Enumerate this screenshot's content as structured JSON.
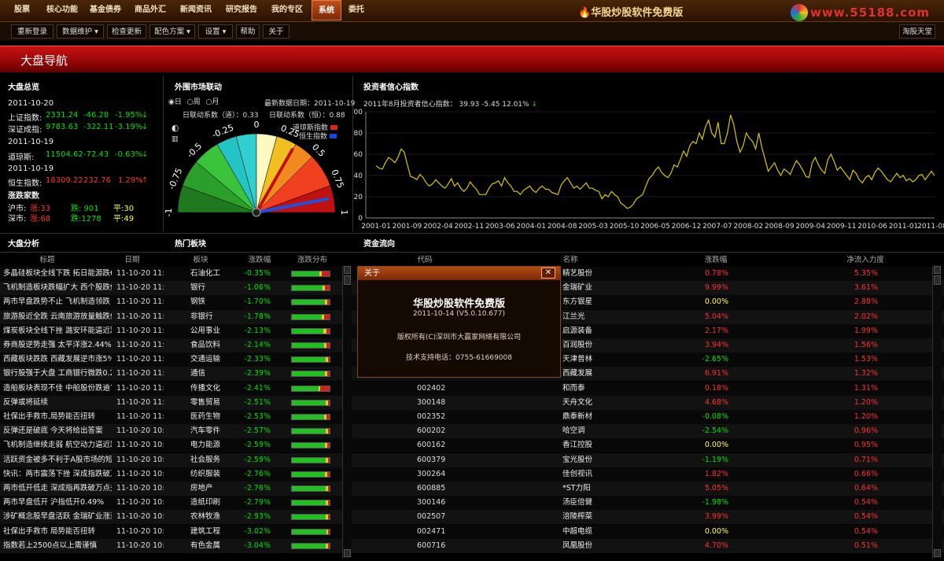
{
  "menu": [
    "股票",
    "核心功能",
    "基金债券",
    "商品外汇",
    "新闻资讯",
    "研究报告",
    "我的专区",
    "系统",
    "委托"
  ],
  "active_menu": 7,
  "app_title": "华股炒股软件免费版",
  "watermark_url": "www.55188.com",
  "toolbar": [
    "重新登录",
    "数据维护 ▾",
    "检查更新",
    "配色方案 ▾",
    "设置 ▾",
    "帮助",
    "关于"
  ],
  "toolbar_right": "淘股天堂",
  "banner_title": "大盘导航",
  "overview": {
    "title": "大盘总览",
    "date1": "2011-10-20",
    "sh_label": "上证指数:",
    "sh_val": "2331.24",
    "sh_chg": "-46.28",
    "sh_pct": "-1.95%",
    "sz_label": "深证成指:",
    "sz_val": "9783.63",
    "sz_chg": "-322.11",
    "sz_pct": "-3.19%",
    "date2": "2011-10-19",
    "dj_label": "道琼斯:",
    "dj_val": "11504.62",
    "dj_chg": "-72.43",
    "dj_pct": "-0.63%",
    "date3": "2011-10-19",
    "hs_label": "恒生指数:",
    "hs_val": "18309.22",
    "hs_chg": "232.76",
    "hs_pct": "1.29%",
    "updown_title": "涨跌家数",
    "sh_market": "沪市:",
    "sh_up": "涨:33",
    "sh_down": "跌: 901",
    "sh_flat": "平:30",
    "sz_market": "深市:",
    "sz_up": "涨:68",
    "sz_down": "跌:1278",
    "sz_flat": "平:49"
  },
  "external": {
    "title": "外围市场联动",
    "opt_day": "日",
    "opt_week": "周",
    "opt_month": "月",
    "latest_date": "最新数据日期：2011-10-19",
    "coef_dj": "日联动系数（道）：0.33",
    "coef_hs": "日联动系数（恒）：0.88",
    "legend_dj": "道琼斯指数",
    "legend_hs": "恒生指数",
    "ticks": [
      "-1",
      "-0.75",
      "-0.5",
      "-0.25",
      "0",
      "0.25",
      "0.5",
      "0.75",
      "1"
    ]
  },
  "confidence": {
    "title": "投资者信心指数",
    "header": "2011年8月投资者信心指数：  39.93   -5.45   12.01%",
    "y_ticks": [
      "100",
      "80",
      "60",
      "40",
      "20",
      "0"
    ],
    "x_ticks": [
      "2001-01",
      "2001-09",
      "2002-04",
      "2002-11",
      "2003-06",
      "2004-01",
      "2004-08",
      "2005-03",
      "2005-10",
      "2006-05",
      "2006-12",
      "2007-07",
      "2008-02",
      "2008-09",
      "2009-04",
      "2009-11",
      "2010-06",
      "2011-01",
      "2011-08"
    ]
  },
  "chart_data": {
    "type": "line",
    "title": "投资者信心指数",
    "ylim": [
      0,
      100
    ],
    "x_range": [
      "2001-01",
      "2011-08"
    ],
    "series": [
      {
        "values": [
          49,
          47,
          46,
          52,
          57,
          55,
          52,
          57,
          65,
          62,
          50,
          39,
          38,
          36,
          41,
          38,
          33,
          30,
          32,
          36,
          33,
          30,
          28,
          32,
          37,
          30,
          33,
          28,
          25,
          28,
          34,
          30,
          27,
          22,
          22,
          22,
          28,
          32,
          33,
          35,
          30,
          38,
          33,
          30,
          25,
          25,
          22,
          26,
          28,
          30,
          26,
          24,
          28,
          30,
          27,
          27,
          24,
          23,
          22,
          31,
          35,
          38,
          33,
          28,
          30,
          27,
          30,
          33,
          28,
          28,
          26,
          25,
          18,
          22,
          20,
          25,
          22,
          20,
          14,
          12,
          9,
          10,
          13,
          18,
          20,
          22,
          30,
          37,
          40,
          45,
          48,
          43,
          40,
          38,
          42,
          50,
          48,
          55,
          63,
          58,
          68,
          72,
          70,
          80,
          74,
          86,
          92,
          80,
          76,
          90,
          70,
          70,
          80,
          97,
          88,
          72,
          62,
          68,
          80,
          75,
          72,
          65,
          80,
          66,
          55,
          44,
          48,
          52,
          45,
          40,
          46,
          44,
          41,
          48,
          54,
          50,
          45,
          39,
          38,
          52,
          57,
          50,
          45,
          42,
          55,
          60,
          53,
          45,
          48,
          44,
          40,
          36,
          45,
          42,
          36,
          33,
          38,
          40,
          36,
          43,
          47,
          44,
          40,
          36,
          34,
          38,
          42,
          38,
          40,
          35,
          37,
          34,
          36,
          40,
          41,
          36,
          40,
          44,
          40
        ]
      }
    ]
  },
  "analysis": {
    "title": "大盘分析",
    "col_title": "标题",
    "col_date": "日期",
    "rows": [
      {
        "t": "多晶硅板块全线下跌 拓日能源跌6...",
        "d": "11-10-20 11:37"
      },
      {
        "t": "飞机制造板块跌幅扩大 西个股跌停",
        "d": "11-10-20 11:37"
      },
      {
        "t": "两市早盘跌势不止 飞机制造领跌",
        "d": "11-10-20 11:37"
      },
      {
        "t": "旅游股近全跌 云南旅游放量触跌停",
        "d": "11-10-20 11:37"
      },
      {
        "t": "煤炭板块全线下挫 潞安环能逼近跌停",
        "d": "11-10-20 11:37"
      },
      {
        "t": "券商股逆势走强 太平洋涨2.44%",
        "d": "11-10-20 11:37"
      },
      {
        "t": "西藏板块跌跌 西藏发展逆市涨5%",
        "d": "11-10-20 11:37"
      },
      {
        "t": "银行股强于大盘 工商银行微跌0.24%",
        "d": "11-10-20 11:37"
      },
      {
        "t": "造船板块表现不佳 中船股份跌逾7%",
        "d": "11-10-20 11:37"
      },
      {
        "t": "反弹或将延续",
        "d": "11-10-20 11:00"
      },
      {
        "t": "社保出手救市,局势能否扭转",
        "d": "11-10-20 11:00"
      },
      {
        "t": "反弹还是破底 今天将给出答案",
        "d": "11-10-20 10:50"
      },
      {
        "t": "飞机制造继续走弱 航空动力逼近跌停",
        "d": "11-10-20 10:50"
      },
      {
        "t": "活跃资金被多不利于A股市场的短...",
        "d": "11-10-20 10:50"
      },
      {
        "t": "快讯：两市震荡下挫 深成指跌破万点...",
        "d": "11-10-20 10:50"
      },
      {
        "t": "两市低开低走 深成指再跌破万点关",
        "d": "11-10-20 10:50"
      },
      {
        "t": "两市早盘低开 沪指低开0.49%",
        "d": "11-10-20 10:50"
      },
      {
        "t": "涉矿概念股早盘活跃 金瑞矿业涨逾...",
        "d": "11-10-20 10:50"
      },
      {
        "t": "社保出手救市 局势能否扭转",
        "d": "11-10-20 10:50"
      },
      {
        "t": "指数若上2500点以上需谨慎",
        "d": "11-10-20 10:50"
      }
    ]
  },
  "sectors": {
    "title": "热门板块",
    "col_name": "板块",
    "col_pct": "涨跌幅",
    "col_dist": "涨跌分布",
    "rows": [
      {
        "n": "石油化工",
        "p": "-0.35%",
        "g": 0.72,
        "y": 0.08,
        "r": 0.2
      },
      {
        "n": "银行",
        "p": "-1.06%",
        "g": 0.82,
        "y": 0.06,
        "r": 0.12
      },
      {
        "n": "钢铁",
        "p": "-1.70%",
        "g": 0.88,
        "y": 0.05,
        "r": 0.07
      },
      {
        "n": "非银行",
        "p": "-1.78%",
        "g": 0.8,
        "y": 0.05,
        "r": 0.15
      },
      {
        "n": "公用事业",
        "p": "-2.13%",
        "g": 0.84,
        "y": 0.08,
        "r": 0.08
      },
      {
        "n": "食品饮料",
        "p": "-2.14%",
        "g": 0.86,
        "y": 0.06,
        "r": 0.08
      },
      {
        "n": "交通运输",
        "p": "-2.33%",
        "g": 0.9,
        "y": 0.05,
        "r": 0.05
      },
      {
        "n": "通信",
        "p": "-2.39%",
        "g": 0.88,
        "y": 0.06,
        "r": 0.06
      },
      {
        "n": "传播文化",
        "p": "-2.41%",
        "g": 0.7,
        "y": 0.05,
        "r": 0.25
      },
      {
        "n": "零售贸易",
        "p": "-2.51%",
        "g": 0.9,
        "y": 0.05,
        "r": 0.05
      },
      {
        "n": "医药生物",
        "p": "-2.53%",
        "g": 0.86,
        "y": 0.06,
        "r": 0.08
      },
      {
        "n": "汽车零件",
        "p": "-2.57%",
        "g": 0.9,
        "y": 0.05,
        "r": 0.05
      },
      {
        "n": "电力能源",
        "p": "-2.59%",
        "g": 0.88,
        "y": 0.06,
        "r": 0.06
      },
      {
        "n": "社会服务",
        "p": "-2.59%",
        "g": 0.9,
        "y": 0.05,
        "r": 0.05
      },
      {
        "n": "纺织服装",
        "p": "-2.76%",
        "g": 0.88,
        "y": 0.06,
        "r": 0.06
      },
      {
        "n": "房地产",
        "p": "-2.76%",
        "g": 0.9,
        "y": 0.05,
        "r": 0.05
      },
      {
        "n": "造纸印刷",
        "p": "-2.79%",
        "g": 0.9,
        "y": 0.05,
        "r": 0.05
      },
      {
        "n": "农林牧渔",
        "p": "-2.93%",
        "g": 0.9,
        "y": 0.05,
        "r": 0.05
      },
      {
        "n": "建筑工程",
        "p": "-3.02%",
        "g": 0.92,
        "y": 0.04,
        "r": 0.04
      },
      {
        "n": "有色金属",
        "p": "-3.04%",
        "g": 0.9,
        "y": 0.05,
        "r": 0.05
      }
    ]
  },
  "funds": {
    "title": "资金流向",
    "col_code": "代码",
    "col_name": "名称",
    "col_pct": "涨跌幅",
    "col_flow": "净流入力度",
    "rows": [
      {
        "c": "",
        "n": "精艺股份",
        "p": "0.78%",
        "f": "5.35%"
      },
      {
        "c": "",
        "n": "金瑞矿业",
        "p": "9.99%",
        "f": "3.61%"
      },
      {
        "c": "",
        "n": "东方银星",
        "p": "0.00%",
        "f": "2.88%"
      },
      {
        "c": "",
        "n": "江兰光",
        "p": "5.04%",
        "f": "2.02%"
      },
      {
        "c": "",
        "n": "启源装备",
        "p": "2.17%",
        "f": "1.99%"
      },
      {
        "c": "",
        "n": "百润股份",
        "p": "3.94%",
        "f": "1.56%"
      },
      {
        "c": "",
        "n": "天津普林",
        "p": "-2.65%",
        "f": "1.53%"
      },
      {
        "c": "",
        "n": "西藏发展",
        "p": "6.91%",
        "f": "1.32%"
      },
      {
        "c": "002402",
        "n": "和而泰",
        "p": "0.18%",
        "f": "1.31%"
      },
      {
        "c": "300148",
        "n": "天舟文化",
        "p": "4.68%",
        "f": "1.20%"
      },
      {
        "c": "002352",
        "n": "鼎泰新材",
        "p": "-0.08%",
        "f": "1.20%"
      },
      {
        "c": "600202",
        "n": "哈空调",
        "p": "-2.54%",
        "f": "0.96%"
      },
      {
        "c": "600162",
        "n": "香江控股",
        "p": "0.00%",
        "f": "0.95%"
      },
      {
        "c": "600379",
        "n": "宝光股份",
        "p": "-1.19%",
        "f": "0.71%"
      },
      {
        "c": "300264",
        "n": "佳创视讯",
        "p": "1.82%",
        "f": "0.66%"
      },
      {
        "c": "600885",
        "n": "*ST力阳",
        "p": "5.05%",
        "f": "0.64%"
      },
      {
        "c": "300146",
        "n": "汤臣倍健",
        "p": "-1.98%",
        "f": "0.54%"
      },
      {
        "c": "002507",
        "n": "涪陵榨菜",
        "p": "3.99%",
        "f": "0.54%"
      },
      {
        "c": "002471",
        "n": "中超电缆",
        "p": "0.00%",
        "f": "0.54%"
      },
      {
        "c": "600716",
        "n": "凤凰股份",
        "p": "4.70%",
        "f": "0.51%"
      }
    ]
  },
  "about": {
    "title": "关于",
    "close": "✕",
    "name": "华股炒股软件免费版",
    "version": "2011-10-14 (V5.0.10.677)",
    "copyright": "版权所有(C)深圳市大赢家网络有限公司",
    "phone": "技术支持电话：0755-61669008"
  }
}
